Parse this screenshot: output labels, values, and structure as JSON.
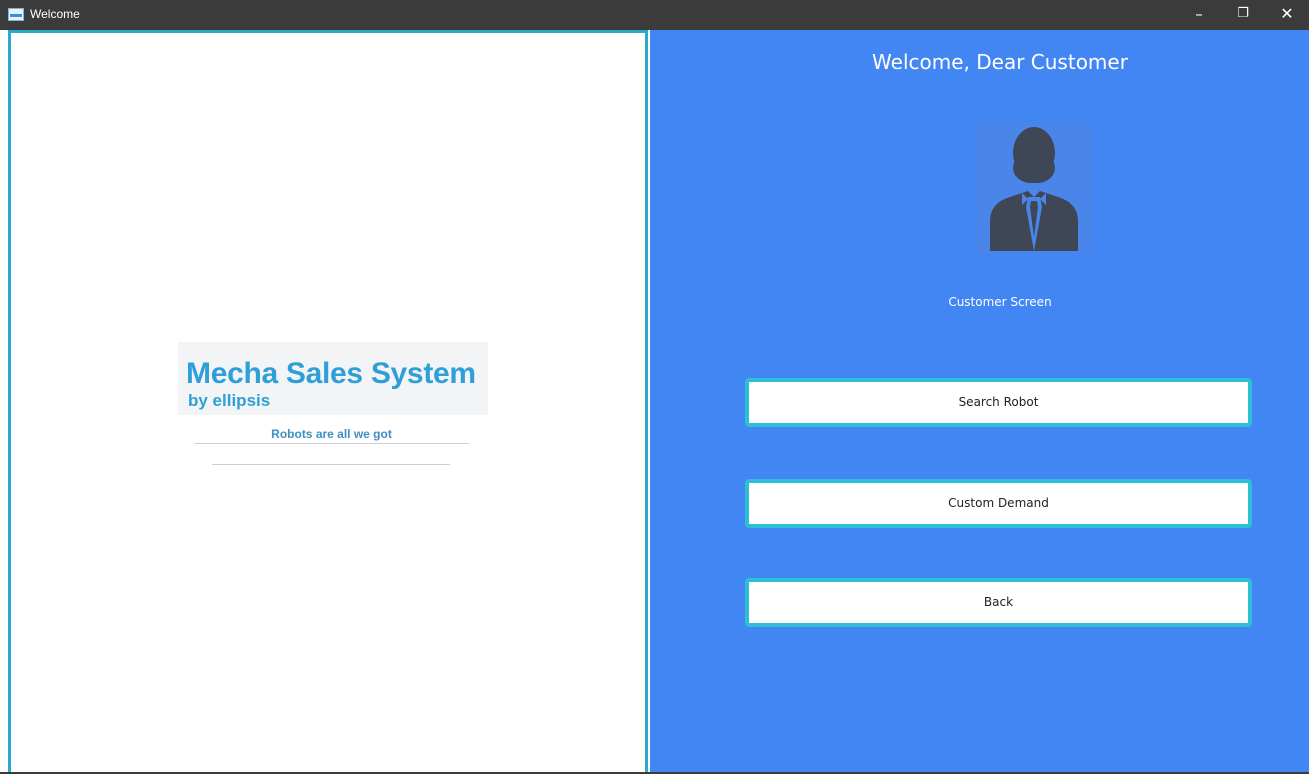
{
  "window": {
    "title": "Welcome",
    "controls": {
      "minimize": "–",
      "maximize": "❐",
      "close": "✕"
    }
  },
  "left": {
    "logo_main": "Mecha Sales System",
    "logo_sub": "by ellipsis",
    "tagline": "Robots are all we got"
  },
  "right": {
    "welcome": "Welcome, Dear Customer",
    "avatar_icon": "customer-avatar-icon",
    "screen_label": "Customer Screen",
    "buttons": {
      "search": "Search Robot",
      "custom": "Custom Demand",
      "back": "Back"
    }
  },
  "colors": {
    "titlebar": "#3b3b3b",
    "left_border": "#2aaac6",
    "right_panel": "#4286f3",
    "button_border": "#2dbfd4",
    "logo": "#2e9fd8",
    "avatar_fill": "#3f4656"
  }
}
